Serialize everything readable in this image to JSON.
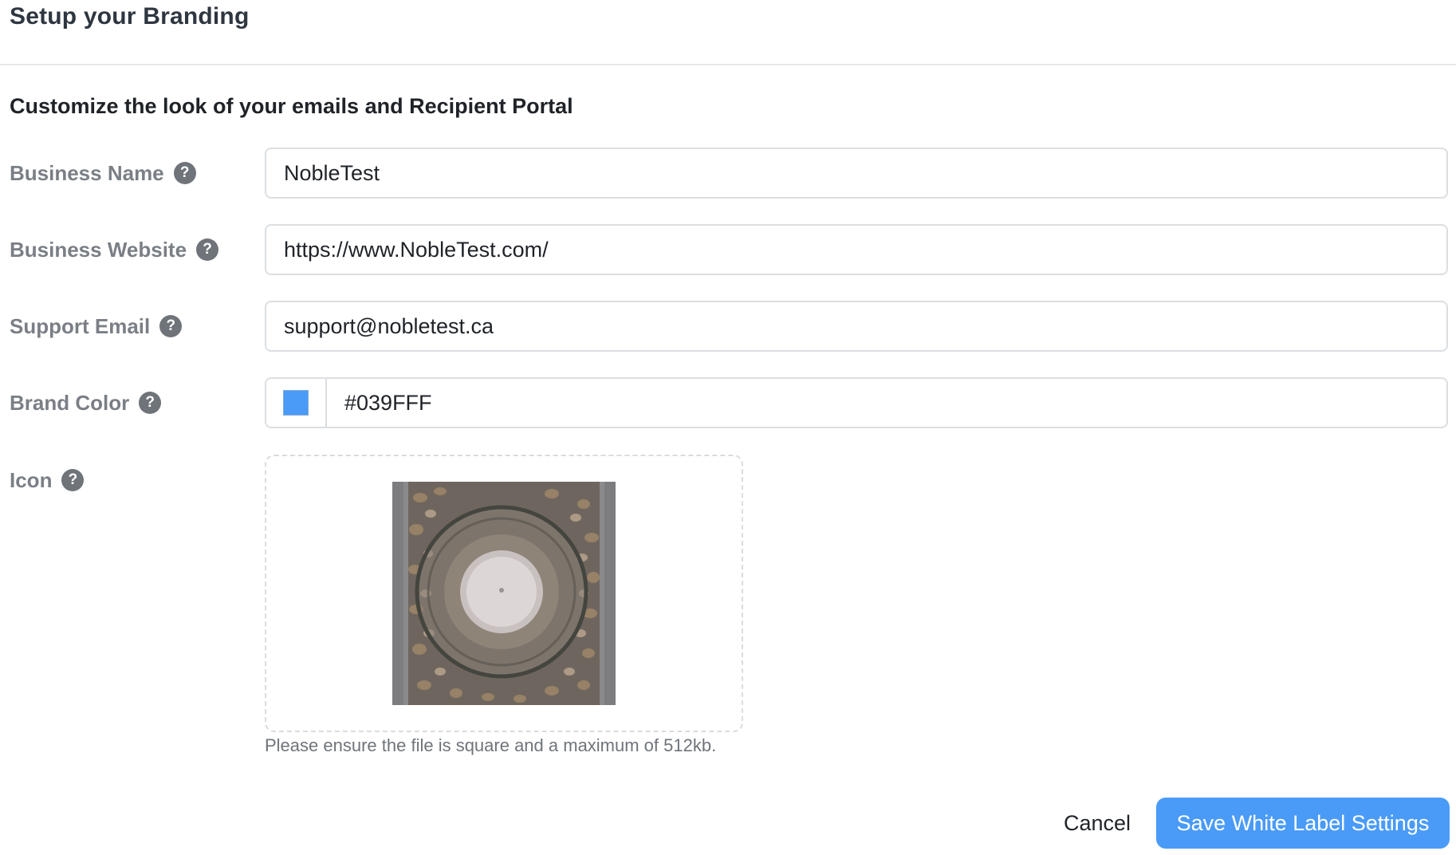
{
  "page": {
    "title": "Setup your Branding"
  },
  "section": {
    "heading": "Customize the look of your emails and Recipient Portal"
  },
  "fields": {
    "business_name": {
      "label": "Business Name",
      "value": "NobleTest",
      "help_icon": "question-circle-icon"
    },
    "business_website": {
      "label": "Business Website",
      "value": "https://www.NobleTest.com/",
      "help_icon": "question-circle-icon"
    },
    "support_email": {
      "label": "Support Email",
      "value": "support@nobletest.ca",
      "help_icon": "question-circle-icon"
    },
    "brand_color": {
      "label": "Brand Color",
      "value": "#039FFF",
      "swatch_color": "#4a9bf7",
      "help_icon": "question-circle-icon"
    },
    "icon": {
      "label": "Icon",
      "help_icon": "question-circle-icon",
      "hint": "Please ensure the file is square and a maximum of 512kb."
    }
  },
  "help_glyph": "?",
  "actions": {
    "cancel_label": "Cancel",
    "save_label": "Save White Label Settings"
  },
  "colors": {
    "primary": "#4a9bf7",
    "label_gray": "#7a7f86",
    "help_icon_bg": "#6f747a",
    "border": "#dcdfe2"
  }
}
